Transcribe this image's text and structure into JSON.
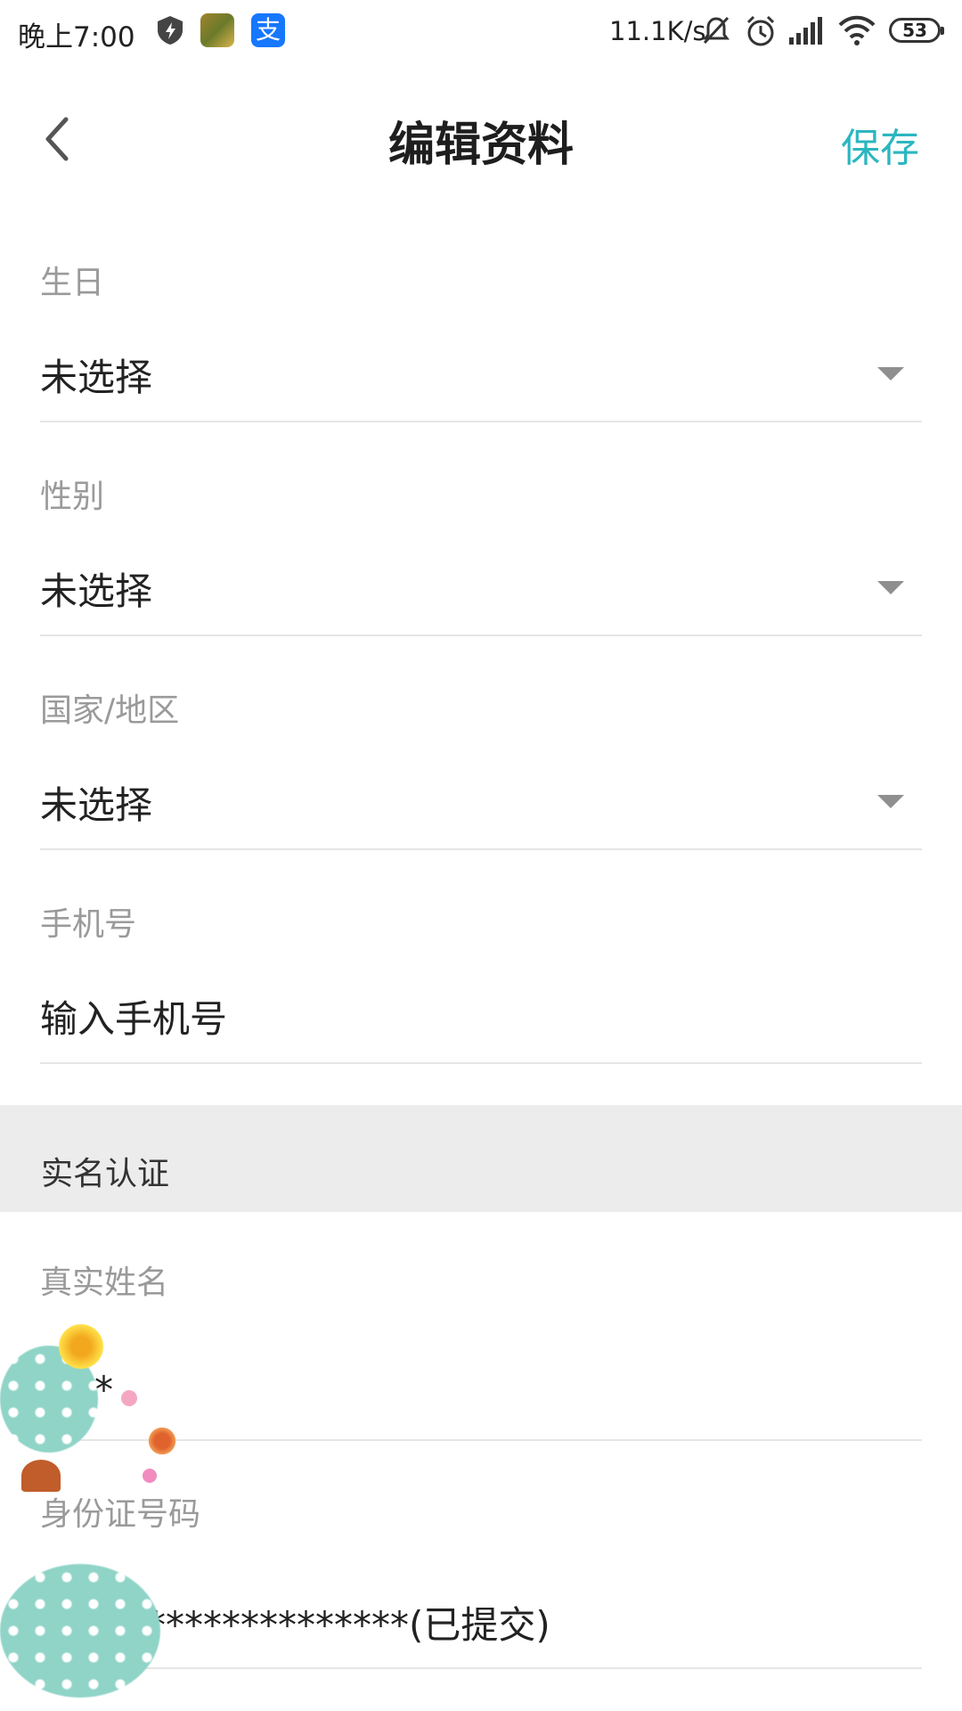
{
  "status_bar": {
    "time": "晚上7:00",
    "network_speed": "11.1K/s",
    "battery": "53",
    "icons": [
      "shield-icon",
      "game-app-icon",
      "alipay-icon",
      "mute-icon",
      "alarm-icon",
      "signal-icon",
      "wifi-icon",
      "battery-icon"
    ]
  },
  "header": {
    "title": "编辑资料",
    "save_label": "保存",
    "back_icon": "chevron-left-icon"
  },
  "fields": {
    "birthday": {
      "label": "生日",
      "value": "未选择"
    },
    "gender": {
      "label": "性别",
      "value": "未选择"
    },
    "region": {
      "label": "国家/地区",
      "value": "未选择"
    },
    "phone": {
      "label": "手机号",
      "placeholder": "输入手机号"
    }
  },
  "verification": {
    "section_title": "实名认证",
    "real_name": {
      "label": "真实姓名",
      "value": "**"
    },
    "id_number": {
      "label": "身份证号码",
      "value": "**************(已提交)"
    }
  },
  "colors": {
    "accent": "#2bb6c0",
    "label_gray": "#9a9a9a",
    "section_bg": "#ececec",
    "divider": "#e6e6e6"
  }
}
